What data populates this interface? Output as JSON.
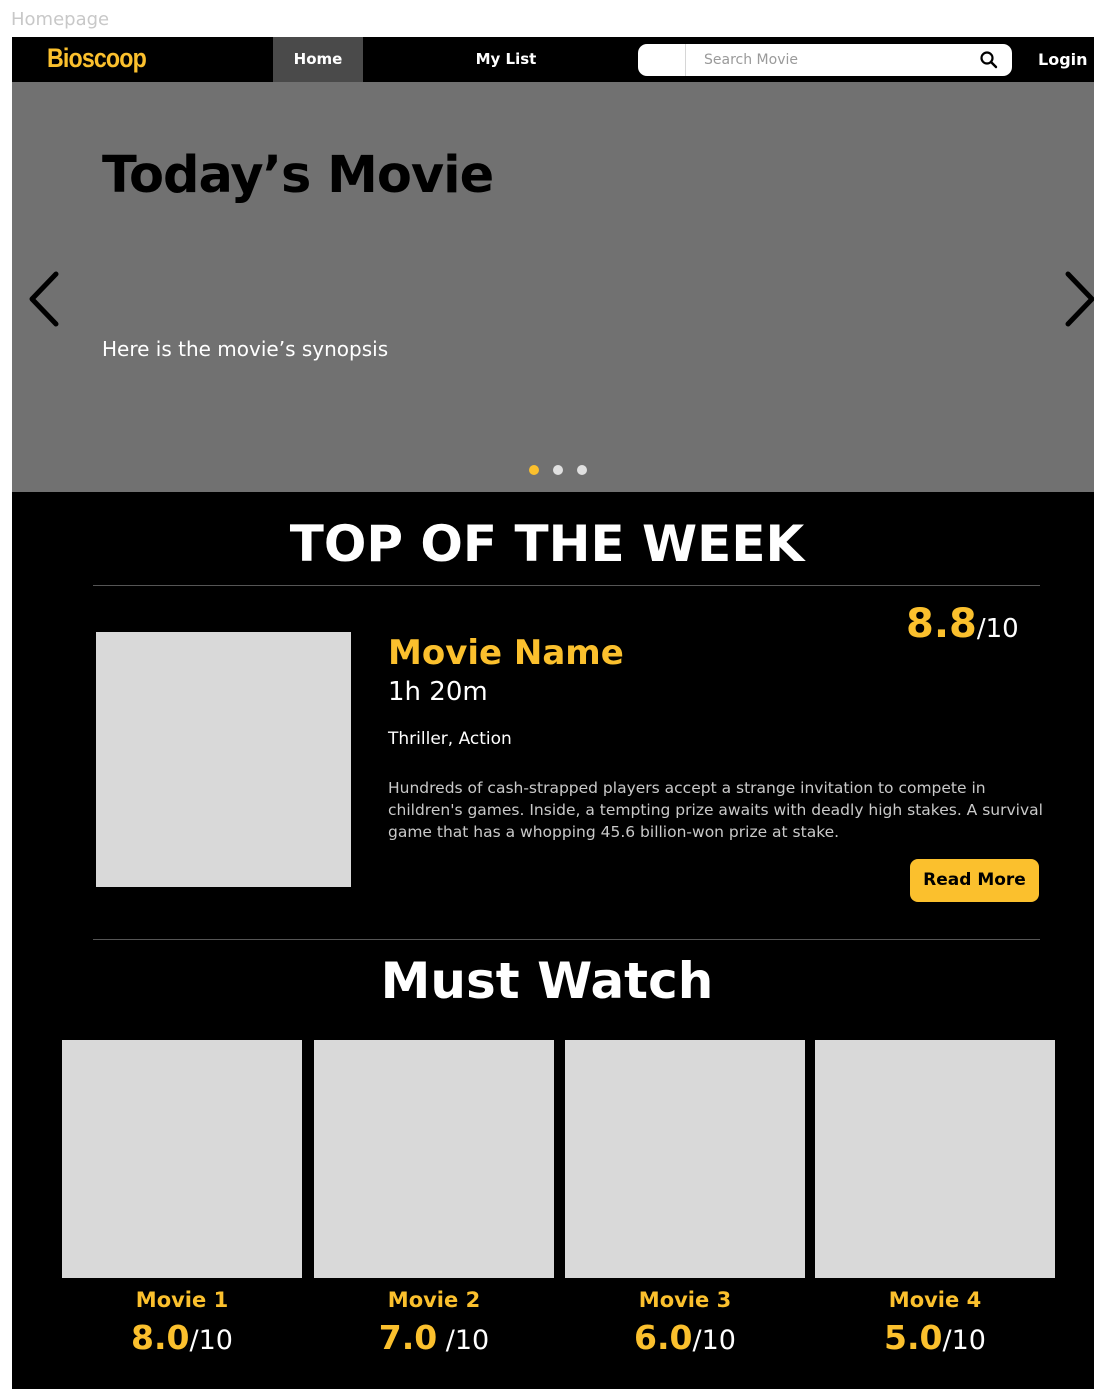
{
  "frame_label": "Homepage",
  "nav": {
    "brand": "Bioscoop",
    "home_label": "Home",
    "mylist_label": "My List",
    "search_placeholder": "Search Movie",
    "login_label": "Login"
  },
  "hero": {
    "title": "Today’s Movie",
    "synopsis": "Here is the movie’s synopsis",
    "dots": 3,
    "active_dot": 1
  },
  "top_week": {
    "heading": "TOP OF THE WEEK",
    "movie_name": "Movie Name",
    "duration": "1h 20m",
    "genres": "Thriller, Action",
    "description": "Hundreds of cash-strapped players accept a strange invitation to compete in children's games. Inside, a tempting prize awaits with deadly high stakes. A survival game that has a whopping 45.6 billion-won prize at stake.",
    "rating": "8.8",
    "rating_max": "/10",
    "read_more_label": "Read More"
  },
  "must_watch": {
    "heading": "Must Watch",
    "movies": [
      {
        "name": "Movie 1",
        "rating": "8.0",
        "max": "/10"
      },
      {
        "name": "Movie 2",
        "rating": "7.0",
        "max": " /10"
      },
      {
        "name": "Movie 3",
        "rating": "6.0",
        "max": "/10"
      },
      {
        "name": "Movie 4",
        "rating": "5.0",
        "max": "/10"
      }
    ]
  },
  "colors": {
    "accent": "#fbc02d",
    "background": "#000000",
    "hero_bg": "#717171",
    "placeholder": "#d9d9d9"
  }
}
